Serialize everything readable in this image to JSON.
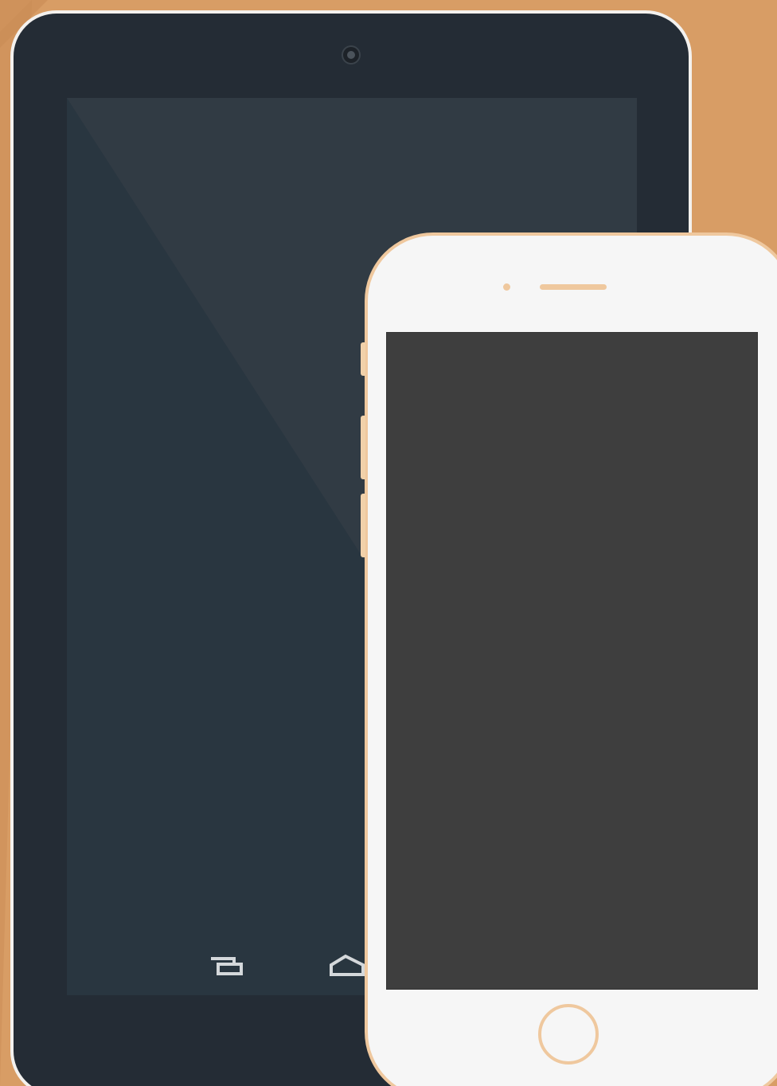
{
  "scene": {
    "background_color": "#d89d65",
    "accent_color": "#efc89e"
  },
  "tablet": {
    "body_color": "#242c35",
    "frame_color": "#f3f1ee",
    "screen_color": "#2a3740",
    "icons": {
      "camera": "camera-icon",
      "recent_apps": "recent-apps-icon",
      "home": "home-icon"
    }
  },
  "phone": {
    "body_color": "#f6f6f6",
    "trim_color": "#efc89e",
    "screen_color": "#3e3e3e",
    "icons": {
      "sensor": "sensor-icon",
      "speaker": "speaker-icon",
      "home_button": "home-button-icon"
    }
  }
}
